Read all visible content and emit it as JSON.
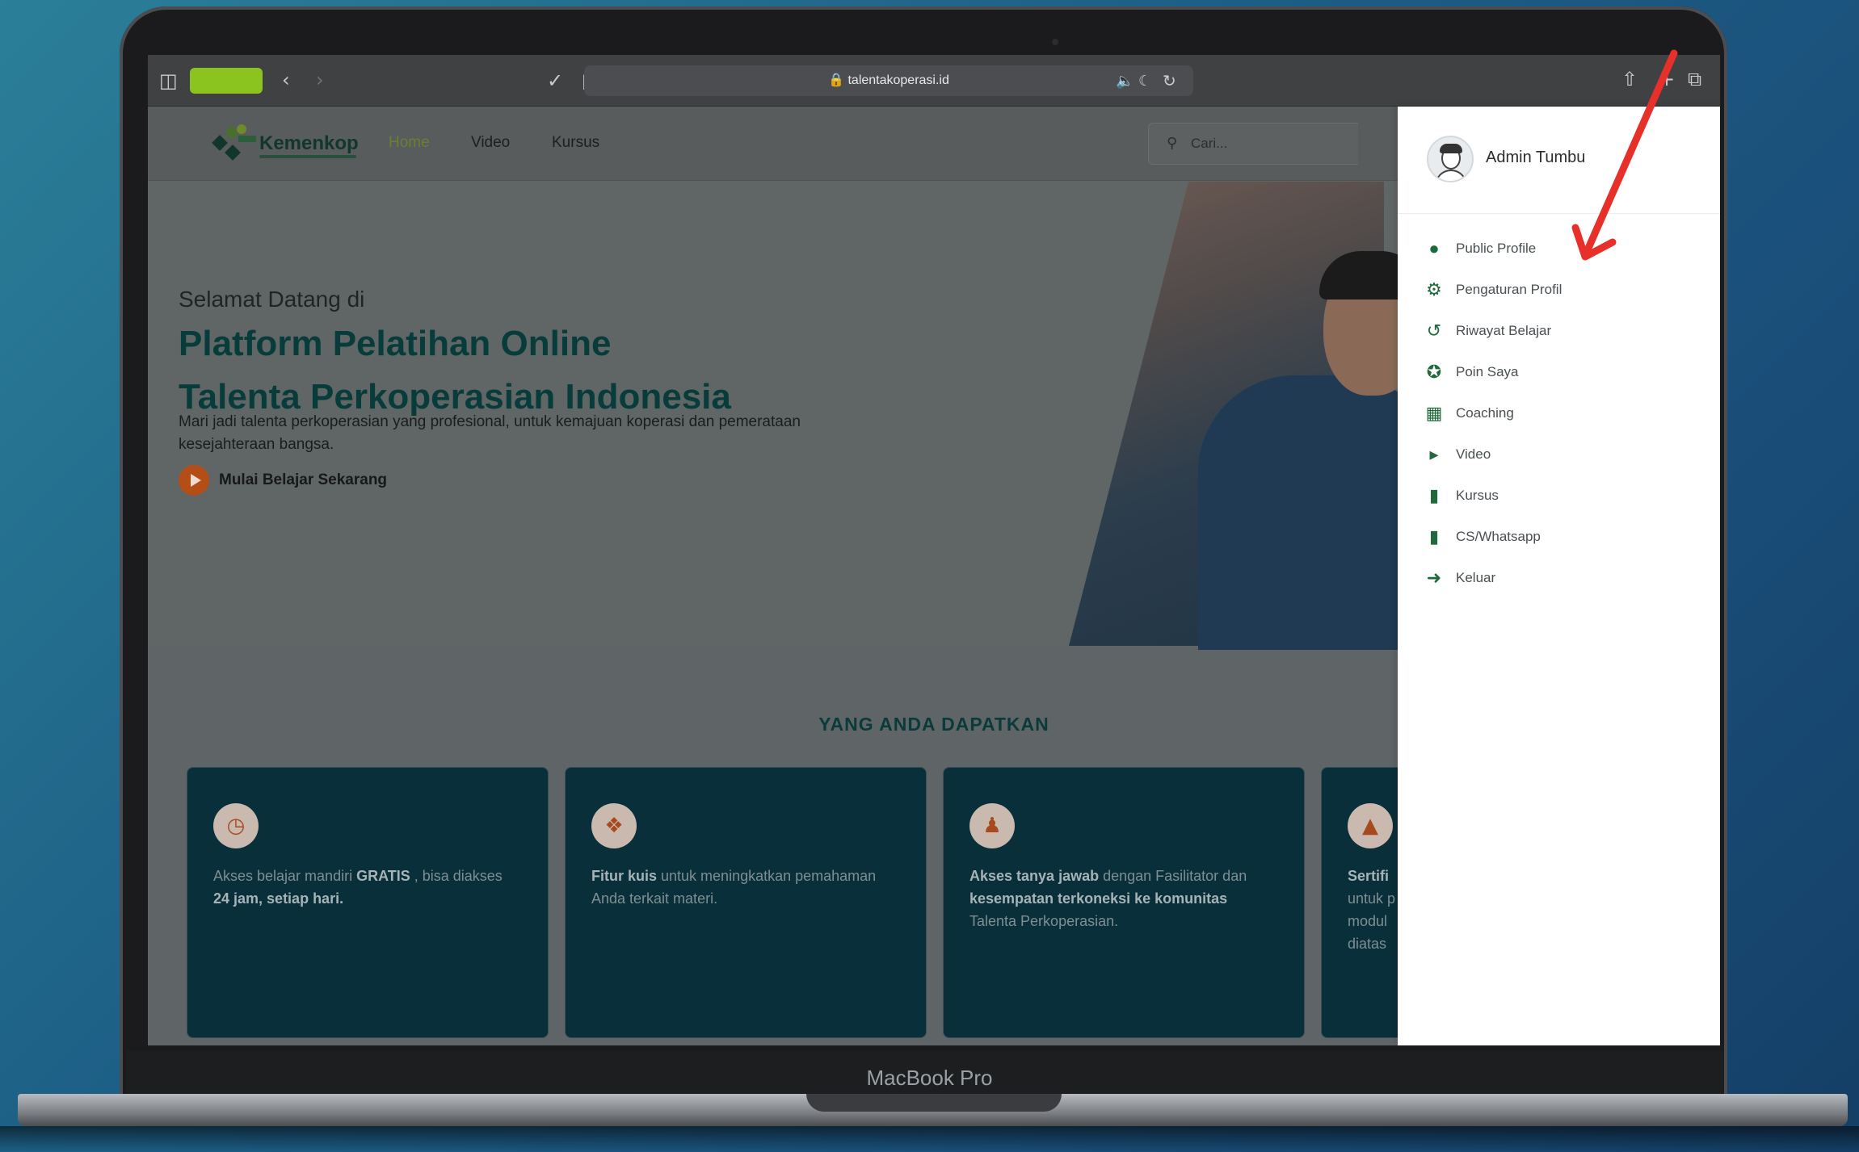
{
  "device": {
    "brand_label": "MacBook Pro"
  },
  "browser": {
    "url": "talentakoperasi.id",
    "lock_icon": "lock-icon"
  },
  "site": {
    "logo_text": "Kemenkop",
    "nav": [
      {
        "label": "Home",
        "active": true
      },
      {
        "label": "Video",
        "active": false
      },
      {
        "label": "Kursus",
        "active": false
      }
    ],
    "search": {
      "placeholder": "Cari..."
    }
  },
  "hero": {
    "kicker": "Selamat Datang di",
    "title_line1": "Platform Pelatihan Online",
    "title_line2": "Talenta Perkoperasian Indonesia",
    "description": "Mari jadi talenta perkoperasian yang profesional, untuk kemajuan koperasi dan pemerataan kesejahteraan bangsa.",
    "cta_label": "Mulai Belajar Sekarang"
  },
  "benefits": {
    "section_title": "YANG ANDA DAPATKAN",
    "cards": [
      {
        "icon": "clock-icon",
        "parts": [
          "Akses belajar mandiri ",
          "GRATIS",
          " , bisa diakses ",
          "24 jam, setiap hari.",
          ""
        ]
      },
      {
        "icon": "award-icon",
        "parts": [
          "",
          "Fitur kuis",
          " untuk meningkatkan pemahaman Anda terkait materi.",
          "",
          ""
        ]
      },
      {
        "icon": "users-icon",
        "parts": [
          "",
          "Akses tanya jawab",
          " dengan Fasilitator dan ",
          "kesempatan terkoneksi ke komunitas",
          " Talenta Perkoperasian."
        ]
      },
      {
        "icon": "graduation-cap-icon",
        "parts": [
          "",
          "Sertifi",
          "",
          "",
          ""
        ],
        "lines": [
          "untuk p",
          "modul",
          "diatas"
        ]
      }
    ]
  },
  "user_menu": {
    "user_name": "Admin Tumbu",
    "items": [
      {
        "label": "Public Profile",
        "icon": "user-icon"
      },
      {
        "label": "Pengaturan Profil",
        "icon": "gear-icon"
      },
      {
        "label": "Riwayat Belajar",
        "icon": "history-icon"
      },
      {
        "label": "Poin Saya",
        "icon": "star-badge-icon"
      },
      {
        "label": "Coaching",
        "icon": "calendar-icon"
      },
      {
        "label": "Video",
        "icon": "video-camera-icon"
      },
      {
        "label": "Kursus",
        "icon": "book-icon"
      },
      {
        "label": "CS/Whatsapp",
        "icon": "book-icon"
      },
      {
        "label": "Keluar",
        "icon": "logout-icon"
      }
    ]
  },
  "colors": {
    "accent_green": "#1f6a3a",
    "hero_title": "#073c3b",
    "card_bg": "#082f3a",
    "cta_orange": "#b44e16",
    "annotation_arrow": "#e8302a",
    "tab_pill": "#8bc41e"
  }
}
